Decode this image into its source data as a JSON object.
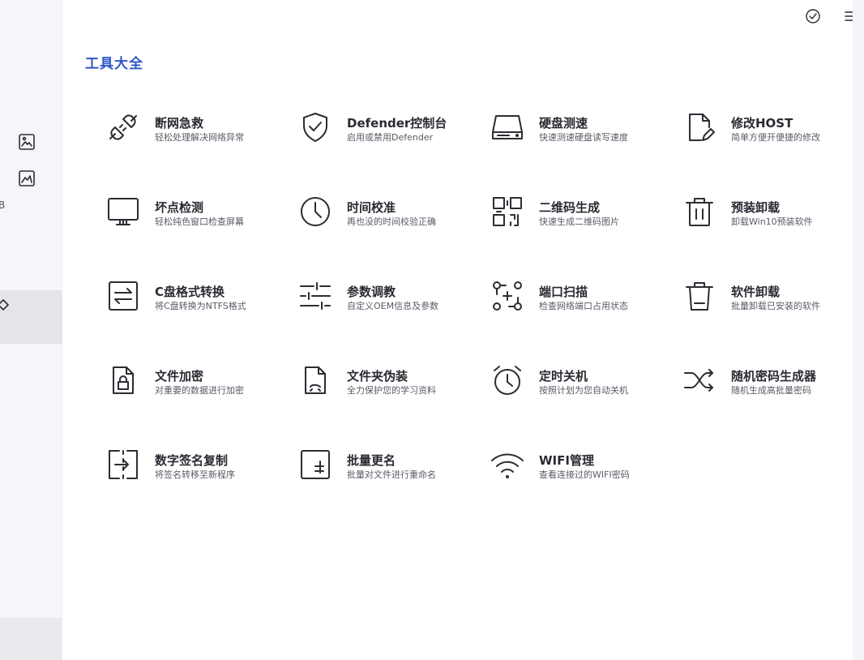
{
  "header": {
    "title": "工具大全",
    "buttons": [
      {
        "name": "feedback",
        "icon": "check-circle-icon"
      },
      {
        "name": "menu",
        "icon": "menu-icon"
      },
      {
        "name": "minimize",
        "icon": "minimize-icon"
      }
    ]
  },
  "sidebar": {
    "edge_text": "B",
    "items": [
      {
        "icon": "image-frame-icon"
      },
      {
        "icon": "image-edit-icon"
      },
      {
        "icon": "tools-icon",
        "active": true
      }
    ]
  },
  "tools": [
    {
      "name": "断网急救",
      "desc": "轻松处理解决网络异常",
      "icon": "plug-icon"
    },
    {
      "name": "Defender控制台",
      "desc": "启用或禁用Defender",
      "icon": "shield-check-icon"
    },
    {
      "name": "硬盘测速",
      "desc": "快速测速硬盘读写速度",
      "icon": "hard-drive-icon"
    },
    {
      "name": "修改HOST",
      "desc": "简单方便开便捷的修改",
      "icon": "file-edit-icon"
    },
    {
      "name": "坏点检测",
      "desc": "轻松纯色窗口检查屏幕",
      "icon": "monitor-icon"
    },
    {
      "name": "时间校准",
      "desc": "再也没的时间校验正确",
      "icon": "clock-icon"
    },
    {
      "name": "二维码生成",
      "desc": "快速生成二维码图片",
      "icon": "qrcode-icon"
    },
    {
      "name": "预装卸载",
      "desc": "卸载Win10预装软件",
      "icon": "trash-icon"
    },
    {
      "name": "C盘格式转换",
      "desc": "将C盘转换为NTFS格式",
      "icon": "swap-icon"
    },
    {
      "name": "参数调教",
      "desc": "自定义OEM信息及参数",
      "icon": "sliders-icon"
    },
    {
      "name": "端口扫描",
      "desc": "检查网络端口占用状态",
      "icon": "scan-icon"
    },
    {
      "name": "软件卸载",
      "desc": "批量卸载已安装的软件",
      "icon": "trash-bin-icon"
    },
    {
      "name": "文件加密",
      "desc": "对重要的数据进行加密",
      "icon": "file-lock-icon"
    },
    {
      "name": "文件夹伪装",
      "desc": "全力保护您的学习资料",
      "icon": "file-disguise-icon"
    },
    {
      "name": "定时关机",
      "desc": "按照计划为您自动关机",
      "icon": "alarm-clock-icon"
    },
    {
      "name": "随机密码生成器",
      "desc": "随机生成高批量密码",
      "icon": "shuffle-icon"
    },
    {
      "name": "数字签名复制",
      "desc": "将签名转移至新程序",
      "icon": "signature-transfer-icon"
    },
    {
      "name": "批量更名",
      "desc": "批量对文件进行重命名",
      "icon": "rename-icon"
    },
    {
      "name": "WIFI管理",
      "desc": "查看连接过的WIFI密码",
      "icon": "wifi-icon"
    }
  ]
}
